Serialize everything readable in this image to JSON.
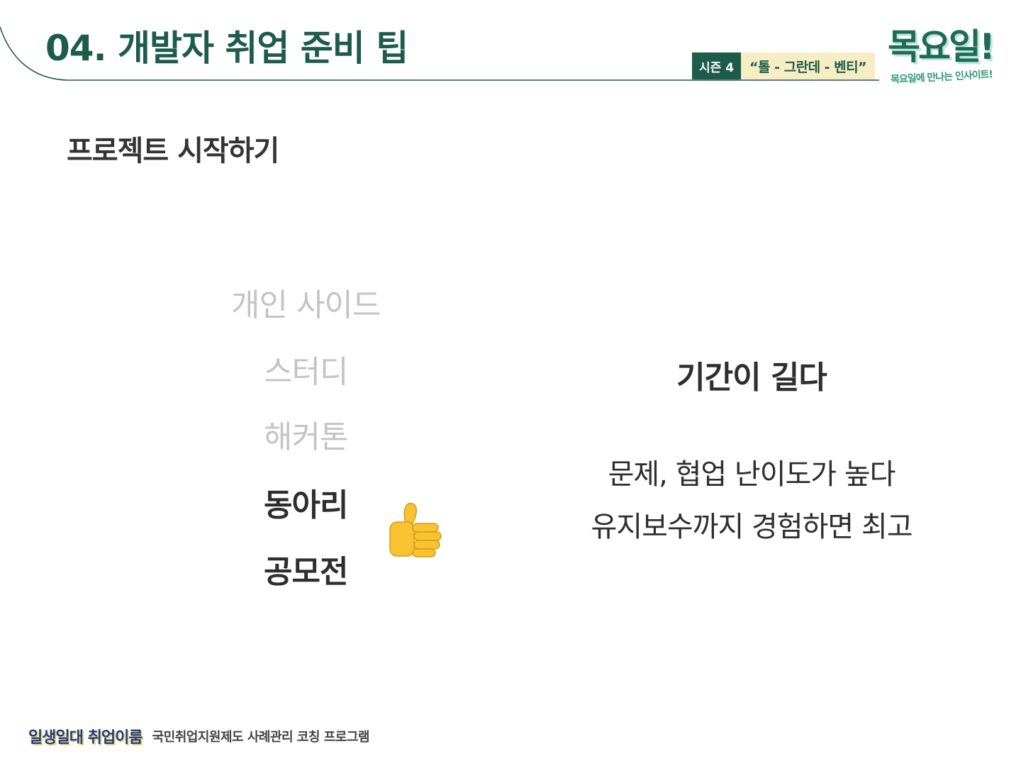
{
  "header": {
    "title": "04. 개발자 취업 준비 팁",
    "season_label": "시즌 4",
    "season_quote": "“톨 - 그란데 - 벤티”"
  },
  "logo": {
    "main": "목요일!",
    "sub": "목요일에 만나는 인사이트!"
  },
  "section": {
    "heading": "프로젝트 시작하기"
  },
  "list": {
    "items": [
      {
        "label": "개인 사이드",
        "state": "muted"
      },
      {
        "label": "스터디",
        "state": "muted"
      },
      {
        "label": "해커톤",
        "state": "muted"
      },
      {
        "label": "동아리",
        "state": "highlighted"
      },
      {
        "label": "공모전",
        "state": "highlighted"
      }
    ]
  },
  "right": {
    "headline": "기간이 길다",
    "line1": "문제, 협업 난이도가 높다",
    "line2": "유지보수까지 경험하면 최고"
  },
  "footer": {
    "brand": "일생일대 취업이룸",
    "program": "국민취업지원제도 사례관리 코칭 프로그램"
  },
  "icons": {
    "thumb": "thumbs-up-icon"
  },
  "colors": {
    "brand_green": "#1d5b4a",
    "badge_cream": "#f6edc4",
    "muted_text": "#c4c4c4",
    "body_text": "#2e2e2e",
    "footer_blue": "#1b3e8a"
  }
}
